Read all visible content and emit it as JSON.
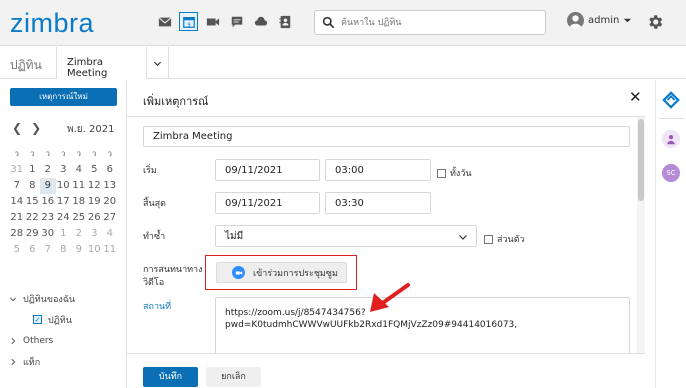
{
  "header": {
    "logo": "zimbra",
    "search_placeholder": "ค้นหาใน ปฏิทิน",
    "user": "admin",
    "app_icons": [
      "mail-icon",
      "calendar-icon",
      "video-icon",
      "chat-icon",
      "cloud-icon",
      "contacts-icon"
    ]
  },
  "tabs": {
    "app_title": "ปฏิทิน",
    "active_tab": "Zimbra Meeting"
  },
  "sidebar": {
    "new_event": "เหตุการณ์ใหม่",
    "month": "พ.ย. 2021",
    "weekdays": [
      "ว",
      "ว",
      "ว",
      "ว",
      "ว",
      "ว",
      "ว"
    ],
    "weeks": [
      [
        {
          "d": "31",
          "dim": true
        },
        {
          "d": "1"
        },
        {
          "d": "2"
        },
        {
          "d": "3"
        },
        {
          "d": "4"
        },
        {
          "d": "5"
        },
        {
          "d": "6"
        }
      ],
      [
        {
          "d": "7"
        },
        {
          "d": "8"
        },
        {
          "d": "9",
          "today": true
        },
        {
          "d": "10"
        },
        {
          "d": "11"
        },
        {
          "d": "12"
        },
        {
          "d": "13"
        }
      ],
      [
        {
          "d": "14"
        },
        {
          "d": "15"
        },
        {
          "d": "16"
        },
        {
          "d": "17"
        },
        {
          "d": "18"
        },
        {
          "d": "19"
        },
        {
          "d": "20"
        }
      ],
      [
        {
          "d": "21"
        },
        {
          "d": "22"
        },
        {
          "d": "23"
        },
        {
          "d": "24"
        },
        {
          "d": "25"
        },
        {
          "d": "26"
        },
        {
          "d": "27"
        }
      ],
      [
        {
          "d": "28"
        },
        {
          "d": "29"
        },
        {
          "d": "30"
        },
        {
          "d": "1",
          "dim": true
        },
        {
          "d": "2",
          "dim": true
        },
        {
          "d": "3",
          "dim": true
        },
        {
          "d": "4",
          "dim": true
        }
      ],
      [
        {
          "d": "5",
          "dim": true
        },
        {
          "d": "6",
          "dim": true
        },
        {
          "d": "7",
          "dim": true
        },
        {
          "d": "8",
          "dim": true
        },
        {
          "d": "9",
          "dim": true
        },
        {
          "d": "10",
          "dim": true
        },
        {
          "d": "11",
          "dim": true
        }
      ]
    ],
    "my_calendars": "ปฏิทินของฉัน",
    "calendar_item": "ปฏิทิน",
    "others": "Others",
    "tags": "แท็ก"
  },
  "dialog": {
    "title": "เพิ่มเหตุการณ์",
    "subject": "Zimbra Meeting",
    "start_label": "เริ่ม",
    "start_date": "09/11/2021",
    "start_time": "03:00",
    "all_day": "ทั้งวัน",
    "end_label": "สิ้นสุด",
    "end_date": "09/11/2021",
    "end_time": "03:30",
    "repeat_label": "ทำซ้ำ",
    "repeat_value": "ไม่มี",
    "private": "ส่วนตัว",
    "video_label_1": "การสนทนาทาง",
    "video_label_2": "วิดีโอ",
    "join_button": "เข้าร่วมการประชุมซูม",
    "location_label": "สถานที่",
    "location_line1": "https://zoom.us/j/8547434756?",
    "location_line2": "pwd=K0tudmhCWWVwUUFkb2Rxd1FQMjVzZz09#94414016073,",
    "save": "บันทึก",
    "cancel": "ยกเลิก"
  },
  "rail": {
    "avatar_initials": "SC"
  },
  "colors": {
    "brand": "#0a7bc9",
    "primary_button": "#0a6fb5",
    "highlight_border": "#e02020"
  }
}
